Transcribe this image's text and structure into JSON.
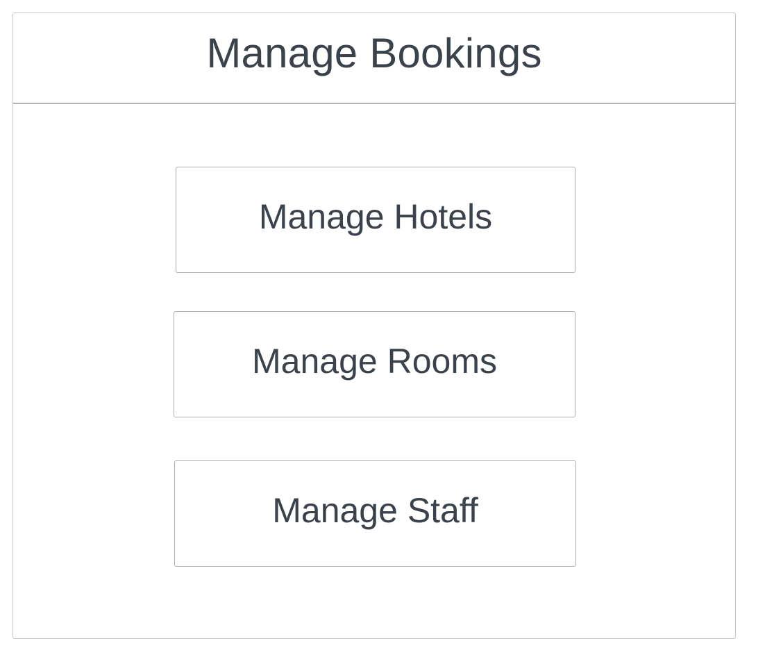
{
  "header": {
    "title": "Manage Bookings"
  },
  "menu": {
    "items": [
      {
        "label": "Manage Hotels"
      },
      {
        "label": "Manage Rooms"
      },
      {
        "label": "Manage Staff"
      }
    ]
  },
  "colors": {
    "text": "#3b424c",
    "border": "#a9adb2",
    "background": "#ffffff"
  }
}
